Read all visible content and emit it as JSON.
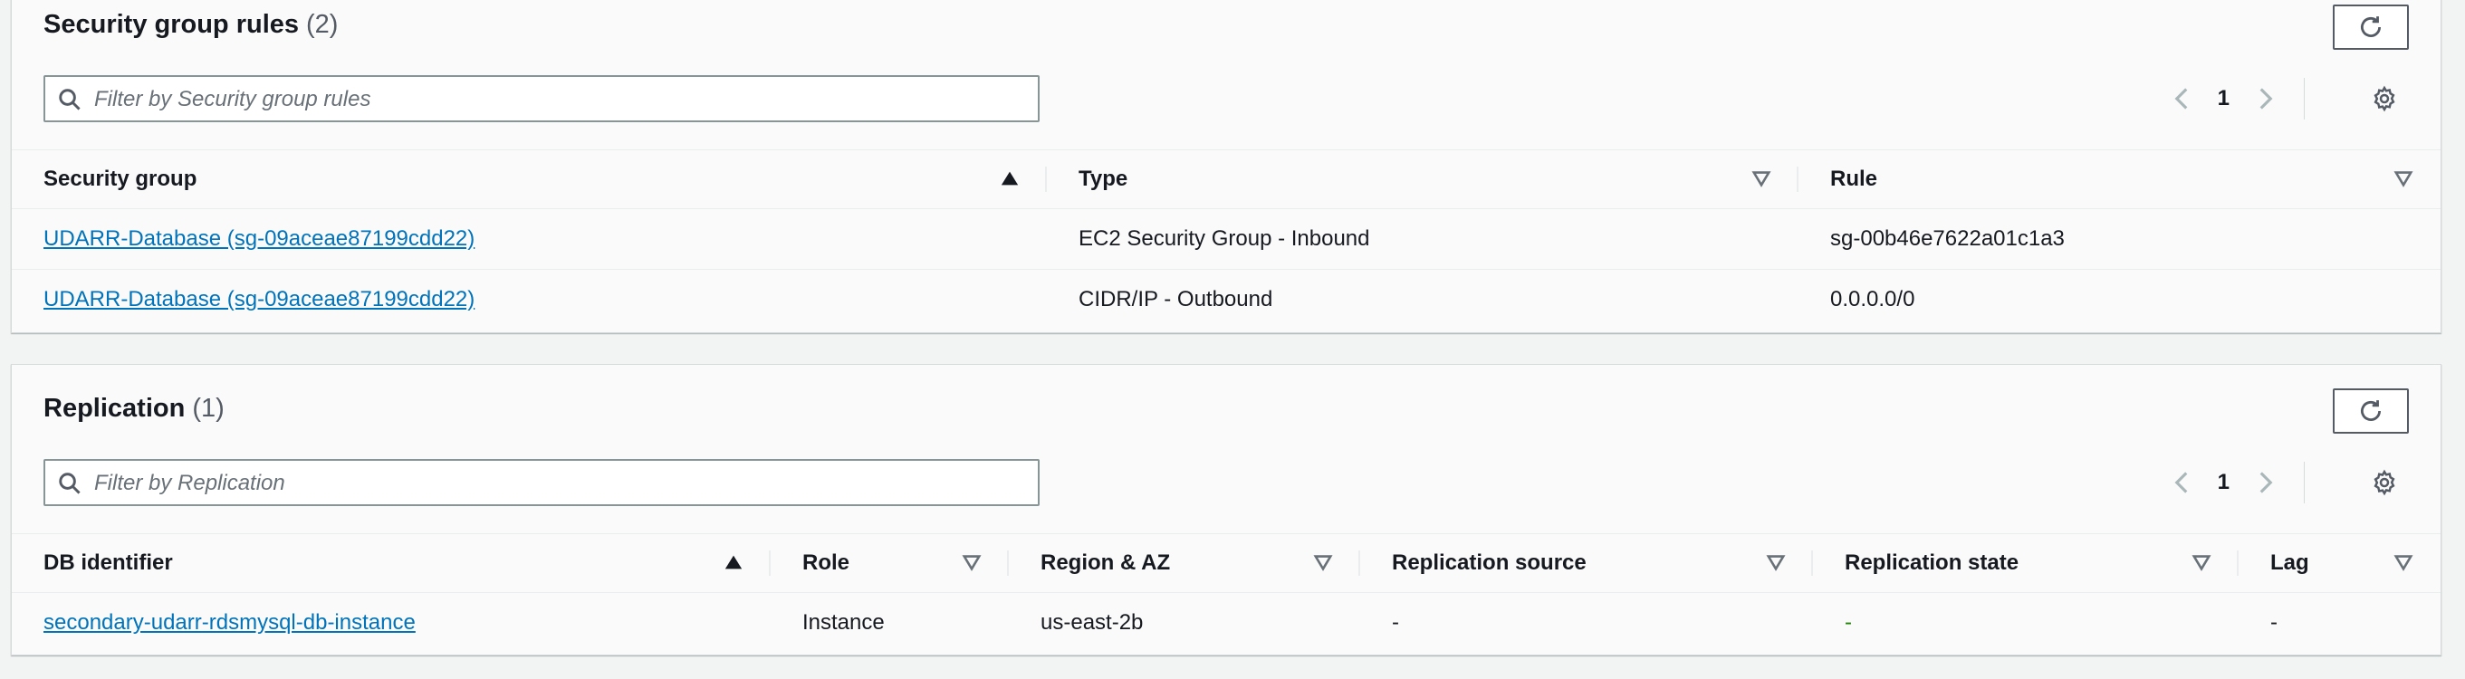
{
  "security_rules": {
    "title": "Security group rules",
    "count": "(2)",
    "filter_placeholder": "Filter by Security group rules",
    "page": "1",
    "columns": [
      "Security group",
      "Type",
      "Rule"
    ],
    "rows": [
      {
        "security_group": "UDARR-Database (sg-09aceae87199cdd22)",
        "type": "EC2 Security Group - Inbound",
        "rule": "sg-00b46e7622a01c1a3"
      },
      {
        "security_group": "UDARR-Database (sg-09aceae87199cdd22)",
        "type": "CIDR/IP - Outbound",
        "rule": "0.0.0.0/0"
      }
    ]
  },
  "replication": {
    "title": "Replication",
    "count": "(1)",
    "filter_placeholder": "Filter by Replication",
    "page": "1",
    "columns": [
      "DB identifier",
      "Role",
      "Region & AZ",
      "Replication source",
      "Replication state",
      "Lag"
    ],
    "rows": [
      {
        "db_identifier": "secondary-udarr-rdsmysql-db-instance",
        "role": "Instance",
        "region_az": "us-east-2b",
        "replication_source": "-",
        "replication_state": "-",
        "lag": "-"
      }
    ]
  },
  "icons": {
    "refresh": "refresh-icon",
    "search": "search-icon",
    "prev": "chevron-left-icon",
    "next": "chevron-right-icon",
    "settings": "gear-icon",
    "sort_asc": "sort-ascending-icon",
    "sort_desc": "sort-descending-icon"
  },
  "colors": {
    "link": "#0073bb",
    "status_green": "#1d8102",
    "text": "#16191f",
    "muted": "#545b64"
  }
}
